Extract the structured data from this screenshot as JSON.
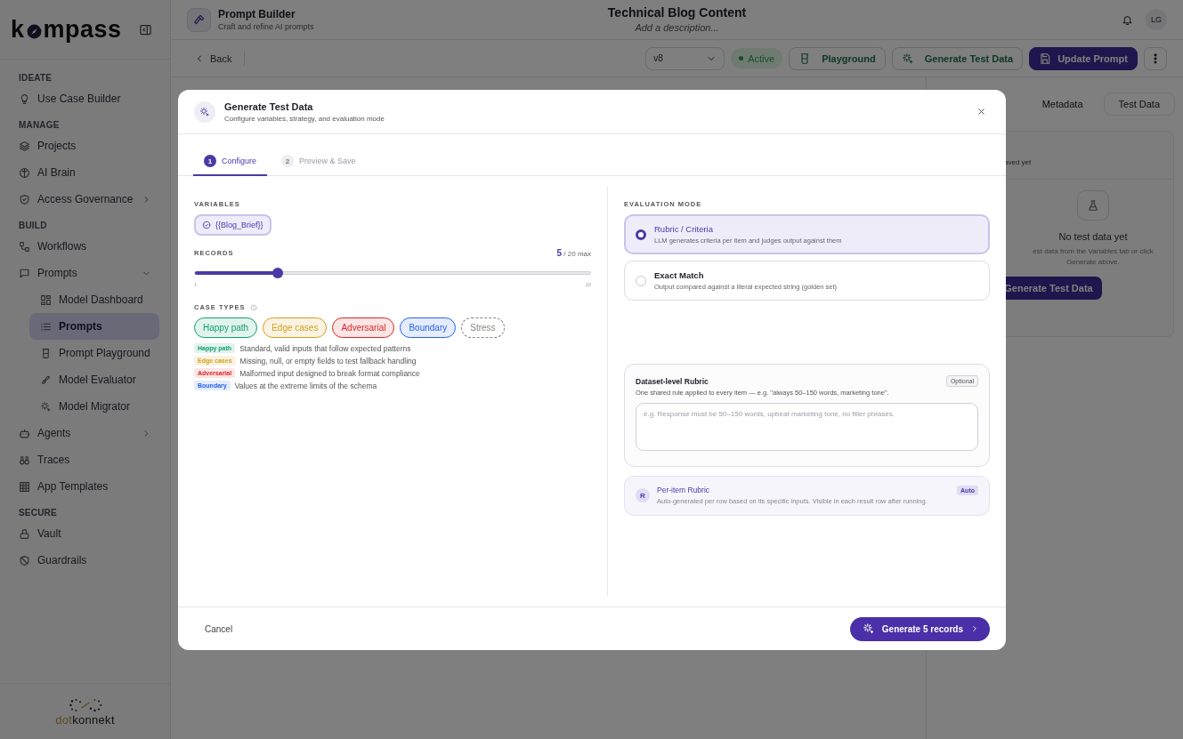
{
  "sidebar": {
    "brand": {
      "before": "k",
      "after": "mpass"
    },
    "sections": [
      {
        "heading": "IDEATE",
        "items": [
          {
            "label": "Use Case Builder",
            "selected": false
          }
        ]
      },
      {
        "heading": "MANAGE",
        "items": [
          {
            "label": "Projects",
            "selected": false
          },
          {
            "label": "AI Brain",
            "selected": false
          },
          {
            "label": "Access Governance",
            "selected": false,
            "expanded": false
          }
        ]
      },
      {
        "heading": "BUILD",
        "items": [
          {
            "label": "Workflows",
            "selected": false
          },
          {
            "label": "Prompts",
            "selected": false,
            "expanded": true,
            "children": [
              {
                "label": "Model Dashboard",
                "selected": false
              },
              {
                "label": "Prompts",
                "selected": true
              },
              {
                "label": "Prompt Playground",
                "selected": false
              },
              {
                "label": "Model Evaluator",
                "selected": false
              },
              {
                "label": "Model Migrator",
                "selected": false
              }
            ]
          },
          {
            "label": "Agents",
            "selected": false,
            "expanded": false
          },
          {
            "label": "Traces",
            "selected": false
          },
          {
            "label": "App Templates",
            "selected": false
          }
        ]
      },
      {
        "heading": "SECURE",
        "items": [
          {
            "label": "Vault",
            "selected": false
          },
          {
            "label": "Guardrails",
            "selected": false
          }
        ]
      }
    ],
    "footer_logo": {
      "first": "dot",
      "second": "konnekt"
    }
  },
  "header": {
    "title": "Prompt Builder",
    "subtitle": "Craft and refine AI prompts",
    "doc_title": "Technical Blog Content",
    "doc_placeholder": "Add a description...",
    "avatar": "LG"
  },
  "toolbar": {
    "back": "Back",
    "version": "v8",
    "status": "Active",
    "buttons": [
      {
        "label": "Playground",
        "kind": "outline"
      },
      {
        "label": "Generate Test Data",
        "kind": "outline"
      },
      {
        "label": "Update Prompt",
        "kind": "primary"
      }
    ]
  },
  "right_panel": {
    "tabs": [
      {
        "label": "Metadata",
        "selected": false
      },
      {
        "label": "Test Data",
        "selected": true
      }
    ],
    "saved_note": "aved yet",
    "empty_title": "No test data yet",
    "empty_text": "est data from the Variables tab or click Generate above.",
    "button": "Generate Test Data"
  },
  "modal": {
    "title": "Generate Test Data",
    "subtitle": "Configure variables, strategy, and evaluation mode",
    "steps": [
      {
        "number": "1",
        "label": "Configure",
        "selected": true
      },
      {
        "number": "2",
        "label": "Preview & Save",
        "selected": false
      }
    ],
    "variables": {
      "heading": "VARIABLES",
      "chips": [
        "{{Blog_Brief}}"
      ]
    },
    "records": {
      "heading": "RECORDS",
      "reading": "**5** / 20 max",
      "level": 0.21,
      "min": "1",
      "max": "20"
    },
    "case_types": {
      "heading": "CASE TYPES",
      "chips": [
        {
          "label": "Happy path",
          "selected": true,
          "color": "#0f9f6e"
        },
        {
          "label": "Edge cases",
          "selected": true,
          "color": "#d4a017"
        },
        {
          "label": "Adversarial",
          "selected": true,
          "color": "#dc2626"
        },
        {
          "label": "Boundary",
          "selected": true,
          "color": "#2563eb"
        },
        {
          "label": "Stress",
          "selected": false,
          "color": "#8a8580"
        }
      ],
      "legend": [
        {
          "tag": "Happy path",
          "text": "Standard, valid inputs that follow expected patterns",
          "color": "#0f9f6e"
        },
        {
          "tag": "Edge cases",
          "text": "Missing, null, or empty fields to test fallback handling",
          "color": "#d4a017"
        },
        {
          "tag": "Adversarial",
          "text": "Malformed input designed to break format compliance",
          "color": "#dc2626"
        },
        {
          "tag": "Boundary",
          "text": "Values at the extreme limits of the schema",
          "color": "#2563eb"
        }
      ]
    },
    "evaluation": {
      "heading": "EVALUATION MODE",
      "options": [
        {
          "title": "Rubric / Criteria",
          "description": "LLM generates criteria per item and judges output against them",
          "selected": true
        },
        {
          "title": "Exact Match",
          "description": "Output compared against a literal expected string (golden set)",
          "selected": false
        }
      ]
    },
    "dataset_rubric": {
      "title": "Dataset-level Rubric",
      "badge": "Optional",
      "description": "One shared rule applied to every item — e.g. \"always 50–150 words, marketing tone\".",
      "placeholder": "e.g. Response must be 50–150 words, upbeat marketing tone, no filler phrases."
    },
    "item_rubric": {
      "avatar": "R",
      "title": "Per-item Rubric",
      "badge": "Auto",
      "description": "Auto-generated per row based on its specific inputs. Visible in each result row after running."
    },
    "cancel": "Cancel",
    "submit": "Generate 5 records"
  }
}
